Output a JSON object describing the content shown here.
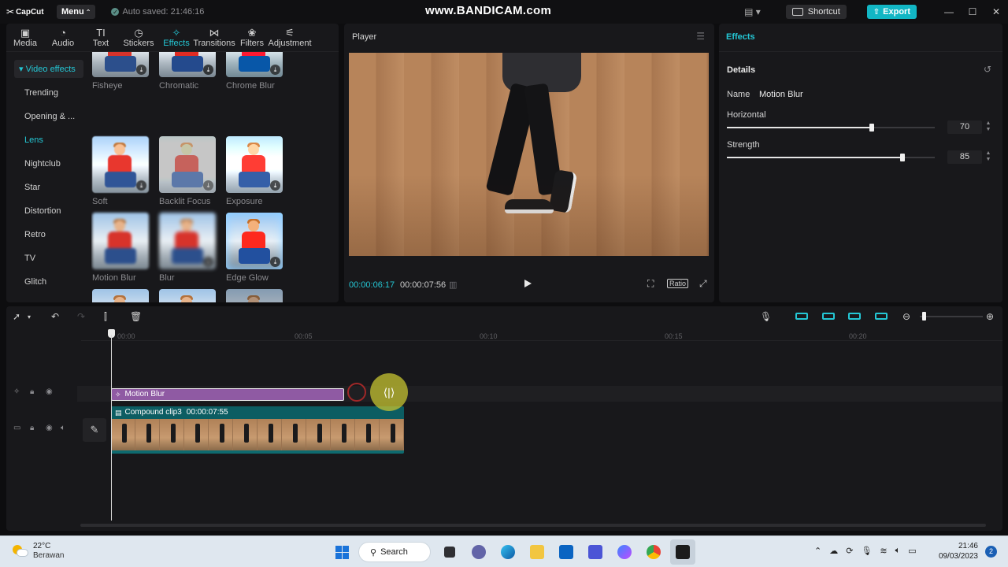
{
  "app": {
    "logo": "CapCut",
    "menu_label": "Menu",
    "autosave": "Auto saved: 21:46:16",
    "watermark": "www.BANDICAM.com",
    "shortcut_label": "Shortcut",
    "export_label": "Export"
  },
  "tabs": [
    {
      "label": "Media",
      "icon": "media-icon",
      "active": false
    },
    {
      "label": "Audio",
      "icon": "audio-icon",
      "active": false
    },
    {
      "label": "Text",
      "icon": "text-icon",
      "active": false
    },
    {
      "label": "Stickers",
      "icon": "sticker-icon",
      "active": false
    },
    {
      "label": "Effects",
      "icon": "effects-icon",
      "active": true
    },
    {
      "label": "Transitions",
      "icon": "transitions-icon",
      "active": false
    },
    {
      "label": "Filters",
      "icon": "filters-icon",
      "active": false
    },
    {
      "label": "Adjustment",
      "icon": "adjustment-icon",
      "active": false
    }
  ],
  "categories": {
    "group": "Video effects",
    "items": [
      "Trending",
      "Opening & ...",
      "Lens",
      "Nightclub",
      "Star",
      "Distortion",
      "Retro",
      "TV",
      "Glitch"
    ],
    "active": "Lens"
  },
  "effects": [
    {
      "label": "Fisheye"
    },
    {
      "label": "Chromatic"
    },
    {
      "label": "Chrome Blur"
    },
    {
      "label": "Soft"
    },
    {
      "label": "Backlit Focus"
    },
    {
      "label": "Exposure"
    },
    {
      "label": "Motion Blur"
    },
    {
      "label": "Blur"
    },
    {
      "label": "Edge Glow"
    }
  ],
  "player": {
    "title": "Player",
    "current_time": "00:00:06:17",
    "total_time": "00:00:07:56",
    "ratio_label": "Ratio"
  },
  "inspector": {
    "tab": "Effects",
    "section": "Details",
    "name_label": "Name",
    "name_value": "Motion Blur",
    "params": [
      {
        "label": "Horizontal",
        "value": "70",
        "fraction": 0.7
      },
      {
        "label": "Strength",
        "value": "85",
        "fraction": 0.85
      }
    ]
  },
  "timeline": {
    "ruler": [
      "00:00",
      "00:05",
      "00:10",
      "00:15",
      "00:20"
    ],
    "effect_clip": "Motion Blur",
    "video_clip": "Compound clip3",
    "video_clip_duration": "00:00:07:55"
  },
  "taskbar": {
    "temperature": "22°C",
    "weather": "Berawan",
    "search": "Search",
    "time": "21:46",
    "date": "09/03/2023",
    "notifications": "2"
  },
  "colors": {
    "accent": "#24c7d5",
    "export": "#12b6c4",
    "effect_clip": "#8f5aa3",
    "video_clip": "#0e6a6f"
  }
}
